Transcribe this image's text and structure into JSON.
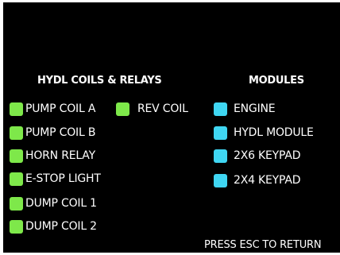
{
  "colors": {
    "background": "#000000",
    "text": "#ffffff",
    "coil_indicator": "#7ee84a",
    "module_indicator": "#3fd6f2"
  },
  "coils": {
    "heading": "HYDL COILS & RELAYS",
    "items": [
      {
        "label": "PUMP COIL A",
        "indicator": "green"
      },
      {
        "label": "PUMP COIL B",
        "indicator": "green"
      },
      {
        "label": "HORN RELAY",
        "indicator": "green"
      },
      {
        "label": "E-STOP LIGHT",
        "indicator": "green"
      },
      {
        "label": "DUMP COIL 1",
        "indicator": "green"
      },
      {
        "label": "DUMP COIL 2",
        "indicator": "green"
      },
      {
        "label": "REV COIL",
        "indicator": "green"
      }
    ]
  },
  "modules": {
    "heading": "MODULES",
    "items": [
      {
        "label": "ENGINE",
        "indicator": "cyan"
      },
      {
        "label": "HYDL MODULE",
        "indicator": "cyan"
      },
      {
        "label": "2X6 KEYPAD",
        "indicator": "cyan"
      },
      {
        "label": "2X4 KEYPAD",
        "indicator": "cyan"
      }
    ]
  },
  "footer": {
    "hint": "PRESS ESC TO RETURN"
  }
}
